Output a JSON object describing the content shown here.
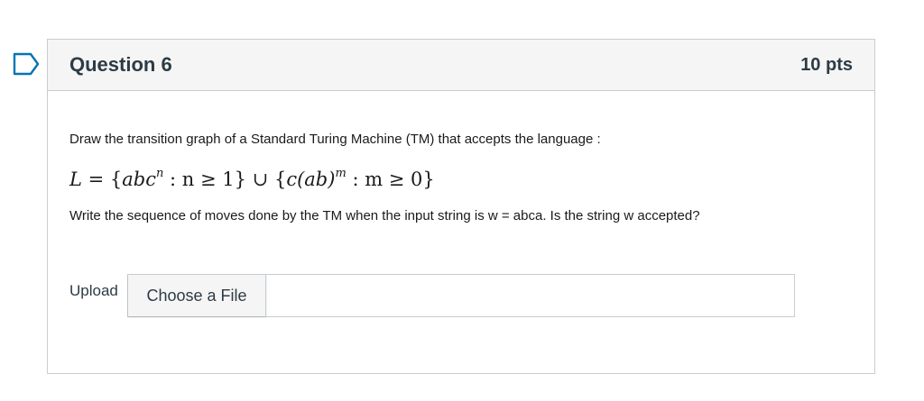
{
  "question": {
    "title": "Question 6",
    "points": "10 pts",
    "prompt": "Draw the transition graph of a Standard Turing Machine (TM) that accepts the language :",
    "formula": {
      "lhs": "L",
      "eq": " = {",
      "part1_base": "abc",
      "part1_sup": "n",
      "part1_cond": " : n ≥ 1} ∪ {",
      "part2_base": "c(ab)",
      "part2_sup": "m",
      "part2_cond": " : m ≥ 0}"
    },
    "followup": "Write the sequence of moves done by the TM when the input string is w = abca. Is the string w accepted?",
    "upload_label": "Upload",
    "choose_file_label": "Choose a File"
  },
  "icons": {
    "flag": "bookmark-flag-icon"
  },
  "colors": {
    "accent": "#0374b5",
    "border": "#c7cdd1",
    "header_bg": "#f5f5f5",
    "text": "#2d3b45"
  }
}
